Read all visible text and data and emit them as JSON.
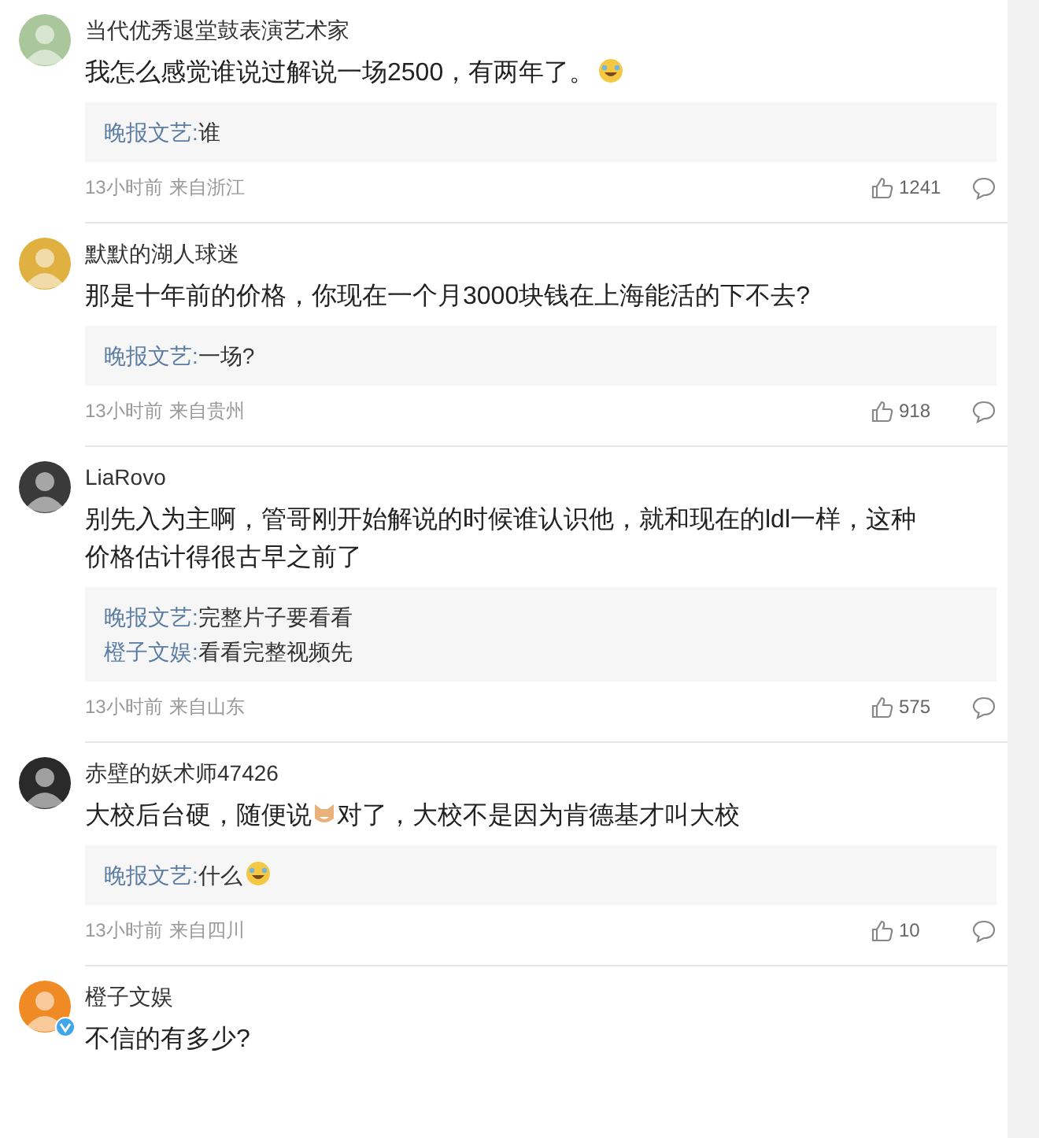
{
  "comments": [
    {
      "user": "当代优秀退堂鼓表演艺术家",
      "color": "#a9c79a",
      "verified": false,
      "content": [
        {
          "kind": "text",
          "text": "我怎么感觉谁说过解说一场2500，有两年了。"
        },
        {
          "kind": "laugh"
        }
      ],
      "replies": [
        {
          "user": "晚报文艺:",
          "content": [
            {
              "kind": "text",
              "text": "谁"
            }
          ]
        }
      ],
      "meta": {
        "time": "13小时前",
        "source": "来自浙江",
        "likes": "1241"
      }
    },
    {
      "user": "默默的湖人球迷",
      "color": "#e0b040",
      "verified": false,
      "content": [
        {
          "kind": "text",
          "text": "那是十年前的价格，你现在一个月3000块钱在上海能活的下不去?"
        }
      ],
      "replies": [
        {
          "user": "晚报文艺:",
          "content": [
            {
              "kind": "text",
              "text": "一场?"
            }
          ]
        }
      ],
      "meta": {
        "time": "13小时前",
        "source": "来自贵州",
        "likes": "918"
      }
    },
    {
      "user": "LiaRovo",
      "color": "#3a3a3a",
      "verified": false,
      "content": [
        {
          "kind": "text",
          "text": "别先入为主啊，管哥刚开始解说的时候谁认识他，就和现在的ldl一样，这种价格估计得很古早之前了"
        }
      ],
      "replies": [
        {
          "user": "晚报文艺:",
          "content": [
            {
              "kind": "text",
              "text": "完整片子要看看"
            }
          ]
        },
        {
          "user": "橙子文娱:",
          "content": [
            {
              "kind": "text",
              "text": "看看完整视频先"
            }
          ]
        }
      ],
      "meta": {
        "time": "13小时前",
        "source": "来自山东",
        "likes": "575"
      }
    },
    {
      "user": "赤壁的妖术师47426",
      "color": "#2a2a2a",
      "verified": false,
      "content": [
        {
          "kind": "text",
          "text": "大校后台硬，随便说"
        },
        {
          "kind": "cat"
        },
        {
          "kind": "text",
          "text": "对了，大校不是因为肯德基才叫大校"
        }
      ],
      "replies": [
        {
          "user": "晚报文艺:",
          "content": [
            {
              "kind": "text",
              "text": "什么"
            },
            {
              "kind": "laugh"
            }
          ]
        }
      ],
      "meta": {
        "time": "13小时前",
        "source": "来自四川",
        "likes": "10"
      }
    },
    {
      "user": "橙子文娱",
      "color": "#f08a24",
      "verified": true,
      "content": [
        {
          "kind": "text",
          "text": "不信的有多少?"
        }
      ]
    }
  ]
}
